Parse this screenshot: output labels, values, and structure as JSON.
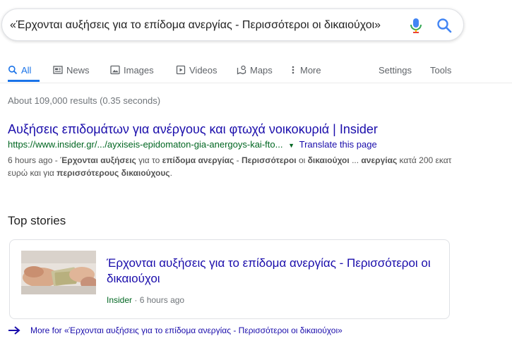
{
  "search": {
    "query": "«Έρχονται αυξήσεις για το επίδομα ανεργίας - Περισσότεροι οι δικαιούχοι»"
  },
  "tabs": [
    {
      "label": "All",
      "icon": "search-icon",
      "active": true
    },
    {
      "label": "News",
      "icon": "news-icon"
    },
    {
      "label": "Images",
      "icon": "image-icon"
    },
    {
      "label": "Videos",
      "icon": "video-icon"
    },
    {
      "label": "Maps",
      "icon": "map-icon"
    },
    {
      "label": "More",
      "icon": "more-vertical-icon"
    },
    {
      "label": "Settings"
    },
    {
      "label": "Tools"
    }
  ],
  "result_stats": "About 109,000 results (0.35 seconds)",
  "result": {
    "title": "Αυξήσεις επιδομάτων για ανέργους και φτωχά νοικοκυριά | Insider",
    "url": "https://www.insider.gr/.../ayxiseis-epidomaton-gia-anergoys-kai-fto...",
    "translate_label": "Translate this page",
    "snippet": [
      {
        "text": "6 hours ago - ",
        "bold": false
      },
      {
        "text": "Έρχονται αυξήσεις",
        "bold": true
      },
      {
        "text": " για το ",
        "bold": false
      },
      {
        "text": "επίδομα ανεργίας",
        "bold": true
      },
      {
        "text": " - ",
        "bold": false
      },
      {
        "text": "Περισσότεροι",
        "bold": true
      },
      {
        "text": " οι ",
        "bold": false
      },
      {
        "text": "δικαιούχοι",
        "bold": true
      },
      {
        "text": " ... ",
        "bold": false
      },
      {
        "text": "ανεργίας",
        "bold": true
      },
      {
        "text": " κατά 200 εκατ ευρώ και για ",
        "bold": false
      },
      {
        "text": "περισσότερους δικαιούχους",
        "bold": true
      },
      {
        "text": ".",
        "bold": false
      }
    ]
  },
  "top_stories": {
    "heading": "Top stories",
    "story": {
      "title": "Έρχονται αυξήσεις για το επίδομα ανεργίας - Περισσότεροι οι δικαιούχοι",
      "source": "Insider",
      "separator": " · ",
      "time": "6 hours ago"
    }
  },
  "more_for": "More for «Έρχονται αυξήσεις για το επίδομα ανεργίας - Περισσότεροι οι δικαιούχοι»",
  "colors": {
    "link": "#1a0dab",
    "url_green": "#006621",
    "accent_blue": "#1a73e8",
    "muted": "#70757a"
  }
}
